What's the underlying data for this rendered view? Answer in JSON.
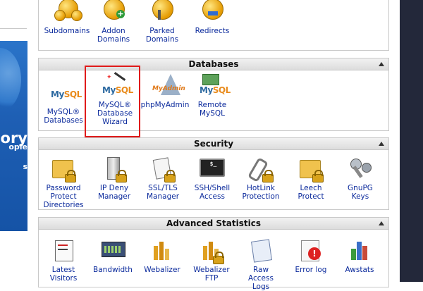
{
  "sidebar": {
    "promo_word": "ory",
    "promo_line1": "ople",
    "promo_line2": "s"
  },
  "domains_panel": {
    "items": [
      {
        "label": "Subdomains",
        "icon": "subdomains-www-icon"
      },
      {
        "label": "Addon\nDomains",
        "icon": "addon-domains-www-icon"
      },
      {
        "label": "Parked\nDomains",
        "icon": "parked-domains-www-icon"
      },
      {
        "label": "Redirects",
        "icon": "redirects-www-icon"
      }
    ]
  },
  "databases_panel": {
    "title": "Databases",
    "items": [
      {
        "label": "MySQL®\nDatabases",
        "icon": "mysql-icon"
      },
      {
        "label": "MySQL®\nDatabase\nWizard",
        "icon": "mysql-wizard-icon"
      },
      {
        "label": "phpMyAdmin",
        "icon": "phpmyadmin-icon"
      },
      {
        "label": "Remote\nMySQL",
        "icon": "remote-mysql-icon"
      }
    ]
  },
  "security_panel": {
    "title": "Security",
    "items": [
      {
        "label": "Password\nProtect\nDirectories",
        "icon": "folder-lock-icon"
      },
      {
        "label": "IP Deny\nManager",
        "icon": "server-lock-icon"
      },
      {
        "label": "SSL/TLS\nManager",
        "icon": "certificate-lock-icon"
      },
      {
        "label": "SSH/Shell\nAccess",
        "icon": "terminal-icon"
      },
      {
        "label": "HotLink\nProtection",
        "icon": "chain-lock-icon"
      },
      {
        "label": "Leech\nProtect",
        "icon": "folder-lock-icon"
      },
      {
        "label": "GnuPG\nKeys",
        "icon": "keys-icon"
      }
    ]
  },
  "stats_panel": {
    "title": "Advanced Statistics",
    "items": [
      {
        "label": "Latest\nVisitors",
        "icon": "visitors-icon"
      },
      {
        "label": "Bandwidth",
        "icon": "bandwidth-icon"
      },
      {
        "label": "Webalizer",
        "icon": "webalizer-chart-icon"
      },
      {
        "label": "Webalizer\nFTP",
        "icon": "webalizer-ftp-icon"
      },
      {
        "label": "Raw\nAccess\nLogs",
        "icon": "raw-logs-icon"
      },
      {
        "label": "Error log",
        "icon": "error-log-icon"
      },
      {
        "label": "Awstats",
        "icon": "awstats-chart-icon"
      }
    ]
  },
  "colors": {
    "link": "#0b2a9c",
    "highlight": "#e01b1b",
    "sidebar_blue": "#1e5fb4",
    "right_bar": "#23283a"
  }
}
